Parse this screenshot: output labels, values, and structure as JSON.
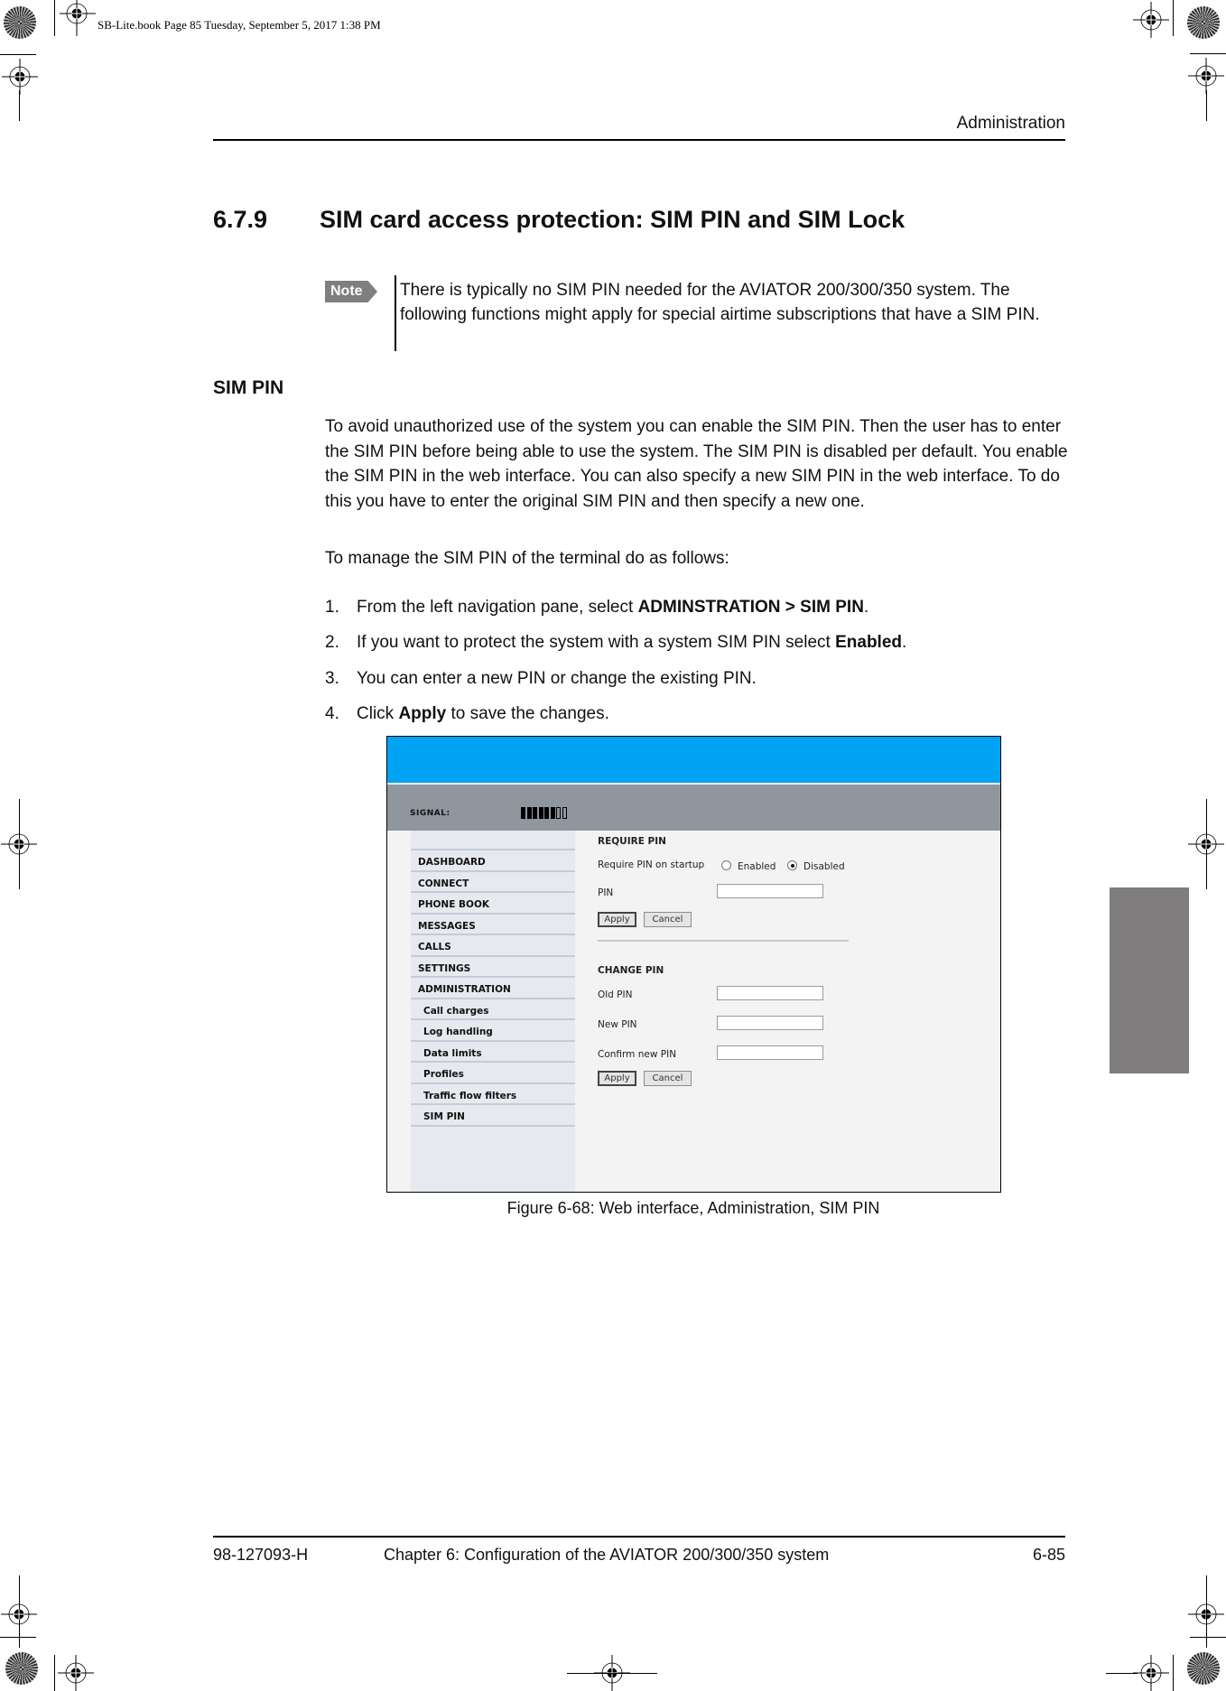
{
  "print_stamp": "SB-Lite.book  Page 85  Tuesday, September 5, 2017  1:38 PM",
  "header": {
    "running_title": "Administration"
  },
  "section": {
    "number": "6.7.9",
    "title": "SIM card access protection: SIM PIN and SIM Lock"
  },
  "note": {
    "badge": "Note",
    "text": "There is typically no SIM PIN needed for the AVIATOR 200/300/350 system. The following functions might apply for special airtime subscriptions that have a SIM PIN."
  },
  "subsection": {
    "heading": "SIM PIN",
    "paragraph": "To avoid unauthorized use of the system you can enable the SIM PIN. Then the user has to enter the SIM PIN before being able to use the system. The SIM PIN is disabled per default. You enable the SIM PIN in the web interface. You can also specify a new SIM PIN in the web interface. To do this you have to enter the original SIM PIN and then specify a new one.",
    "intro": "To manage the SIM PIN of the terminal do as follows:",
    "steps": [
      {
        "num": "1.",
        "pre": "From the left navigation pane, select ",
        "bold": "ADMINSTRATION > SIM PIN",
        "post": "."
      },
      {
        "num": "2.",
        "pre": "If you want to protect the system with a system SIM PIN select ",
        "bold": "Enabled",
        "post": "."
      },
      {
        "num": "3.",
        "pre": "You can enter a new PIN or change the existing PIN.",
        "bold": "",
        "post": ""
      },
      {
        "num": "4.",
        "pre": "Click ",
        "bold": "Apply",
        "post": " to save the changes."
      }
    ]
  },
  "figure": {
    "colors": {
      "top_bar": "#00a3f4",
      "signal_bar": "#8f969e",
      "nav_bg": "#e6e9ee",
      "content_bg": "#f3f3f3"
    },
    "signal": {
      "label": "SIGNAL:",
      "level": 6,
      "max": 8
    },
    "nav": {
      "items": [
        {
          "label": "DASHBOARD",
          "level": "top"
        },
        {
          "label": "CONNECT",
          "level": "top"
        },
        {
          "label": "PHONE BOOK",
          "level": "top"
        },
        {
          "label": "MESSAGES",
          "level": "top"
        },
        {
          "label": "CALLS",
          "level": "top"
        },
        {
          "label": "SETTINGS",
          "level": "top"
        },
        {
          "label": "ADMINISTRATION",
          "level": "top"
        },
        {
          "label": "Call charges",
          "level": "sub"
        },
        {
          "label": "Log handling",
          "level": "sub"
        },
        {
          "label": "Data limits",
          "level": "sub"
        },
        {
          "label": "Profiles",
          "level": "sub"
        },
        {
          "label": "Traffic flow filters",
          "level": "sub"
        },
        {
          "label": "SIM PIN",
          "level": "sub"
        }
      ]
    },
    "require_pin": {
      "heading": "REQUIRE PIN",
      "startup_label": "Require PIN on startup",
      "option_enabled": "Enabled",
      "option_disabled": "Disabled",
      "selected": "Disabled",
      "pin_label": "PIN",
      "pin_value": "",
      "apply": "Apply",
      "cancel": "Cancel"
    },
    "change_pin": {
      "heading": "CHANGE PIN",
      "old_label": "Old PIN",
      "old_value": "",
      "new_label": "New PIN",
      "new_value": "",
      "confirm_label": "Confirm new PIN",
      "confirm_value": "",
      "apply": "Apply",
      "cancel": "Cancel"
    },
    "caption": "Figure 6-68: Web interface, Administration, SIM PIN"
  },
  "footer": {
    "doc_number": "98-127093-H",
    "chapter": "Chapter 6:  Configuration of the AVIATOR 200/300/350 system",
    "page": "6-85"
  }
}
